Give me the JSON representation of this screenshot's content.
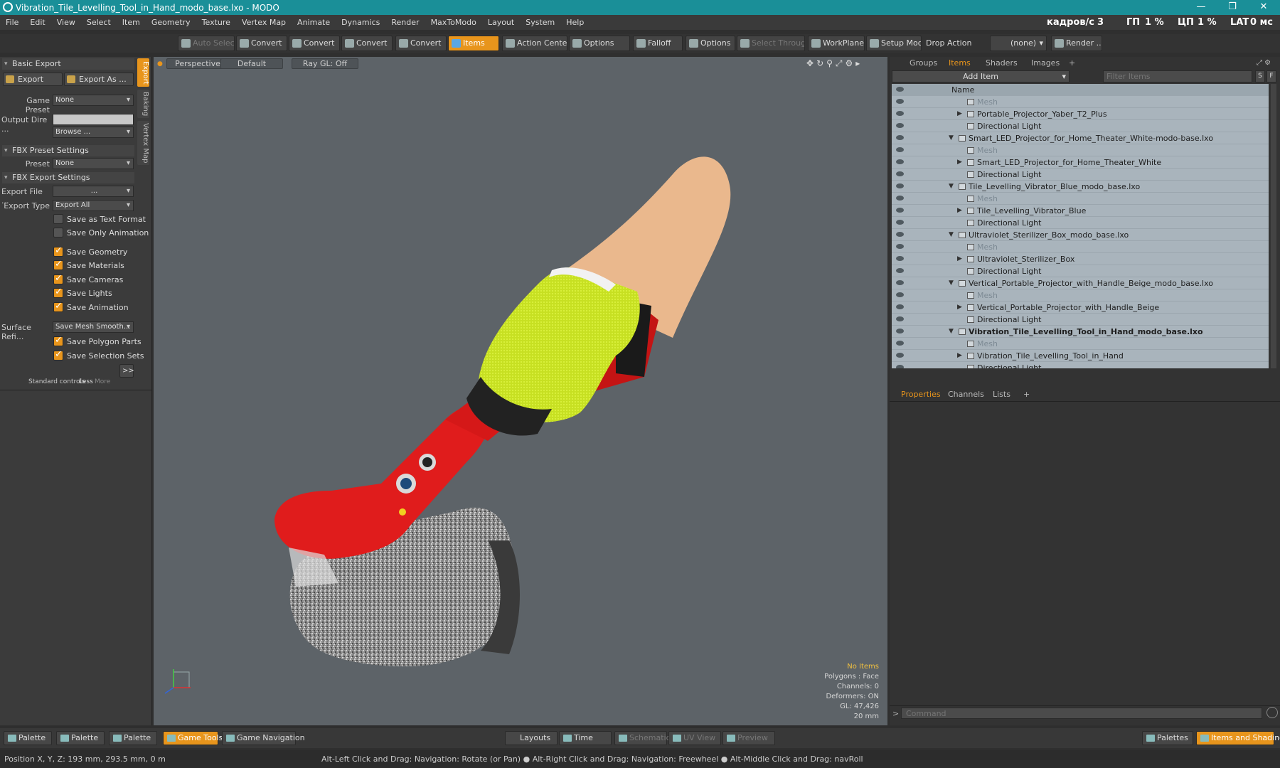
{
  "window": {
    "title": "Vibration_Tile_Levelling_Tool_in_Hand_modo_base.lxo - MODO",
    "controls": [
      "—",
      "❐",
      "✕"
    ]
  },
  "menu": [
    "File",
    "Edit",
    "View",
    "Select",
    "Item",
    "Geometry",
    "Texture",
    "Vertex Map",
    "Animate",
    "Dynamics",
    "Render",
    "MaxToModo",
    "Layout",
    "System",
    "Help"
  ],
  "perf": {
    "fps_label": "кадров/с",
    "fps": "3",
    "gpu_label": "ГП",
    "gpu": "1 %",
    "cpu_label": "ЦП",
    "cpu": "1 %",
    "lat_label": "LAT",
    "lat": "0 мс"
  },
  "toolbar": {
    "auto_select": "Auto Select",
    "convert": "Convert",
    "items": "Items",
    "action_center": "Action Center",
    "options": "Options",
    "falloff": "Falloff",
    "select_through": "Select Through",
    "workplane": "WorkPlane",
    "setup_mode": "Setup Mode",
    "drop_action": "Drop Action",
    "drop_value": "(none)",
    "render": "Render ..."
  },
  "left": {
    "basic_export": "Basic Export",
    "export": "Export",
    "export_as": "Export As ...",
    "game_preset_label": "Game Preset",
    "game_preset": "None",
    "output_dir_label": "Output Dire ...",
    "browse": "Browse ...",
    "fbx_preset": "FBX Preset Settings",
    "preset_label": "Preset",
    "preset": "None",
    "fbx_export": "FBX Export Settings",
    "export_file_label": "Export File ...",
    "export_file": "...",
    "export_type_label": "Export Type",
    "export_type": "Export All",
    "checks": [
      {
        "label": "Save as Text Format",
        "on": false
      },
      {
        "label": "Save Only Animation",
        "on": false
      },
      {
        "label": "Save Geometry",
        "on": true
      },
      {
        "label": "Save Materials",
        "on": true
      },
      {
        "label": "Save Cameras",
        "on": true
      },
      {
        "label": "Save Lights",
        "on": true
      },
      {
        "label": "Save Animation",
        "on": true
      }
    ],
    "surface_label": "Surface Refi...",
    "surface": "Save Mesh Smooth...",
    "checks2": [
      {
        "label": "Save Polygon Parts",
        "on": true
      },
      {
        "label": "Save Selection Sets",
        "on": true
      }
    ],
    "more_btn": ">>",
    "std_controls": "Standard controls",
    "less": "Less",
    "more": "More",
    "vtabs": [
      "Export",
      "Baking",
      "Vertex Map"
    ]
  },
  "viewport": {
    "perspective": "Perspective",
    "default": "Default",
    "raygl": "Ray GL: Off",
    "info": {
      "no_items": "No Items",
      "polygons": "Polygons : Face",
      "channels": "Channels: 0",
      "deformers": "Deformers: ON",
      "gl": "GL: 47,426",
      "scale": "20 mm"
    }
  },
  "right": {
    "tabs": [
      "Groups",
      "Items",
      "Shaders",
      "Images"
    ],
    "add_item": "Add Item",
    "filter": "Filter Items",
    "col_name": "Name",
    "items": [
      {
        "t": "mesh",
        "name": "Mesh"
      },
      {
        "t": "obj",
        "name": "Portable_Projector_Yaber_T2_Plus"
      },
      {
        "t": "light",
        "name": "Directional Light"
      },
      {
        "t": "scene",
        "name": "Smart_LED_Projector_for_Home_Theater_White-modo-base.lxo"
      },
      {
        "t": "mesh",
        "name": "Mesh"
      },
      {
        "t": "obj",
        "name": "Smart_LED_Projector_for_Home_Theater_White"
      },
      {
        "t": "light",
        "name": "Directional Light"
      },
      {
        "t": "scene",
        "name": "Tile_Levelling_Vibrator_Blue_modo_base.lxo"
      },
      {
        "t": "mesh",
        "name": "Mesh"
      },
      {
        "t": "obj",
        "name": "Tile_Levelling_Vibrator_Blue"
      },
      {
        "t": "light",
        "name": "Directional Light"
      },
      {
        "t": "scene",
        "name": "Ultraviolet_Sterilizer_Box_modo_base.lxo"
      },
      {
        "t": "mesh",
        "name": "Mesh"
      },
      {
        "t": "obj",
        "name": "Ultraviolet_Sterilizer_Box"
      },
      {
        "t": "light",
        "name": "Directional Light"
      },
      {
        "t": "scene",
        "name": "Vertical_Portable_Projector_with_Handle_Beige_modo_base.lxo"
      },
      {
        "t": "mesh",
        "name": "Mesh"
      },
      {
        "t": "obj",
        "name": "Vertical_Portable_Projector_with_Handle_Beige"
      },
      {
        "t": "light",
        "name": "Directional Light"
      },
      {
        "t": "scene_bold",
        "name": "Vibration_Tile_Levelling_Tool_in_Hand_modo_base.lxo"
      },
      {
        "t": "mesh",
        "name": "Mesh"
      },
      {
        "t": "obj",
        "name": "Vibration_Tile_Levelling_Tool_in_Hand"
      },
      {
        "t": "light",
        "name": "Directional Light"
      }
    ],
    "prop_tabs": [
      "Properties",
      "Channels",
      "Lists"
    ],
    "command": "Command"
  },
  "bottom": {
    "palette": "Palette",
    "game_tools": "Game Tools",
    "game_nav": "Game Navigation",
    "layouts": "Layouts",
    "time": "Time",
    "schematic": "Schematic",
    "uv_view": "UV View",
    "preview": "Preview",
    "palettes": "Palettes",
    "items_shading": "Items and Shading"
  },
  "status": {
    "position": "Position X, Y, Z:  193 mm, 293.5 mm, 0 m",
    "hint": "Alt-Left Click and Drag: Navigation: Rotate (or Pan) ● Alt-Right Click and Drag: Navigation: Freewheel ● Alt-Middle Click and Drag: navRoll"
  }
}
